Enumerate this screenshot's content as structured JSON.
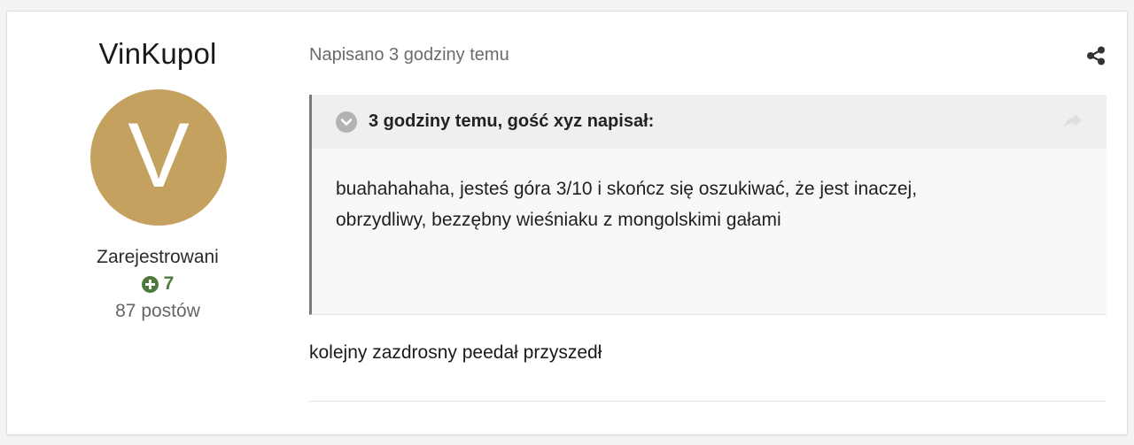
{
  "author": {
    "name": "VinKupol",
    "avatar_letter": "V",
    "avatar_color": "#c4a15f",
    "group": "Zarejestrowani",
    "reputation": "7",
    "reputation_icon": "plus-circle-icon",
    "post_count": "87 postów"
  },
  "post": {
    "meta": "Napisano 3 godziny temu",
    "share_icon": "share-icon",
    "quote": {
      "citation": "3 godziny temu, gość xyz napisał:",
      "toggle_icon": "chevron-down-circle-icon",
      "jump_icon": "share-arrow-icon",
      "text": "buahahahaha, jesteś góra 3/10 i skończ się oszukiwać, że jest inaczej, obrzydliwy, bezzębny wieśniaku z mongolskimi gałami"
    },
    "body": "kolejny zazdrosny peedał przyszedł"
  },
  "colors": {
    "reputation_positive": "#4d7a3b",
    "quote_border": "#7a7a7a"
  }
}
